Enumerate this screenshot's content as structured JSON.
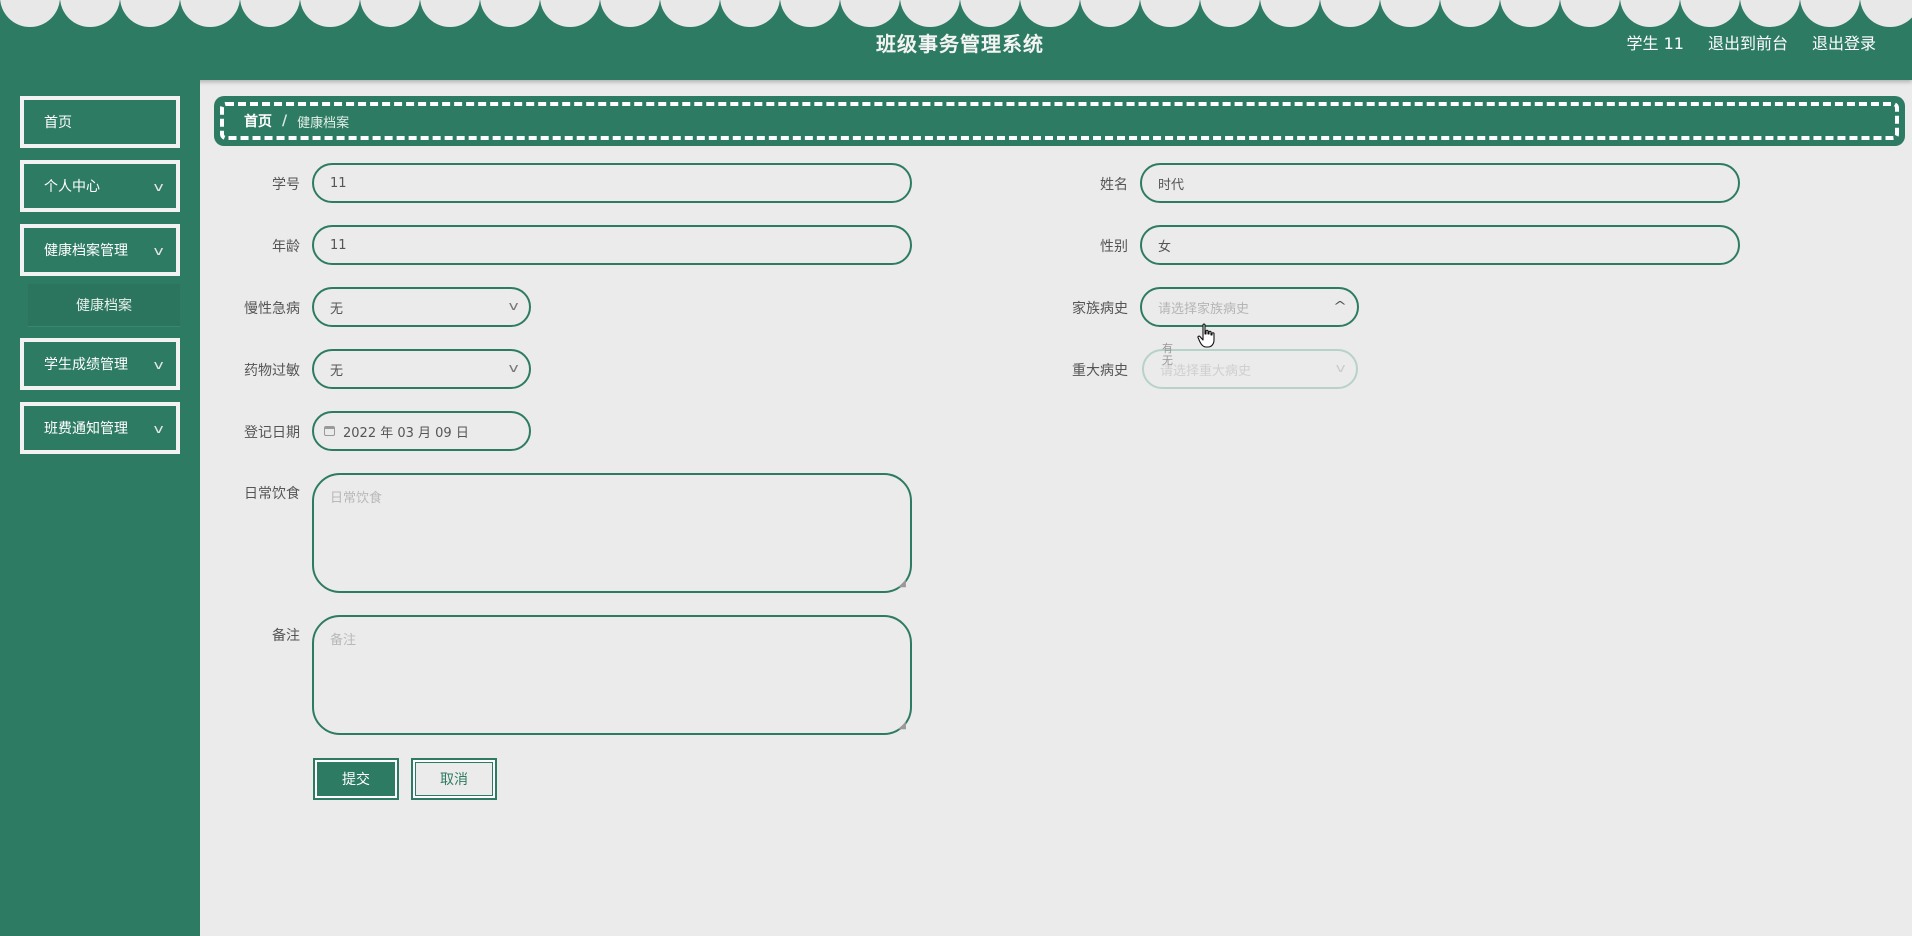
{
  "header": {
    "title": "班级事务管理系统",
    "user": "学生 11",
    "back_front": "退出到前台",
    "logout": "退出登录"
  },
  "sidebar": {
    "items": [
      {
        "label": "首页"
      },
      {
        "label": "个人中心"
      },
      {
        "label": "健康档案管理"
      },
      {
        "label": "学生成绩管理"
      },
      {
        "label": "班费通知管理"
      }
    ],
    "subitem": "健康档案"
  },
  "breadcrumb": {
    "home": "首页",
    "separator": "/",
    "current": "健康档案"
  },
  "form": {
    "student_id": {
      "label": "学号",
      "value": "11"
    },
    "name": {
      "label": "姓名",
      "value": "时代"
    },
    "age": {
      "label": "年龄",
      "value": "11"
    },
    "gender": {
      "label": "性别",
      "value": "女"
    },
    "chronic": {
      "label": "慢性急病",
      "value": "无"
    },
    "family_history": {
      "label": "家族病史",
      "placeholder": "请选择家族病史"
    },
    "allergy": {
      "label": "药物过敏",
      "value": "无"
    },
    "major_history": {
      "label": "重大病史",
      "placeholder": "请选择重大病史"
    },
    "dropdown_options": [
      "有",
      "无"
    ],
    "date": {
      "label": "登记日期",
      "value": "2022 年 03 月 09 日"
    },
    "diet": {
      "label": "日常饮食",
      "placeholder": "日常饮食"
    },
    "remark": {
      "label": "备注",
      "placeholder": "备注"
    },
    "submit": "提交",
    "cancel": "取消"
  },
  "colors": {
    "primary": "#2e7b63",
    "background": "#ebebeb"
  }
}
